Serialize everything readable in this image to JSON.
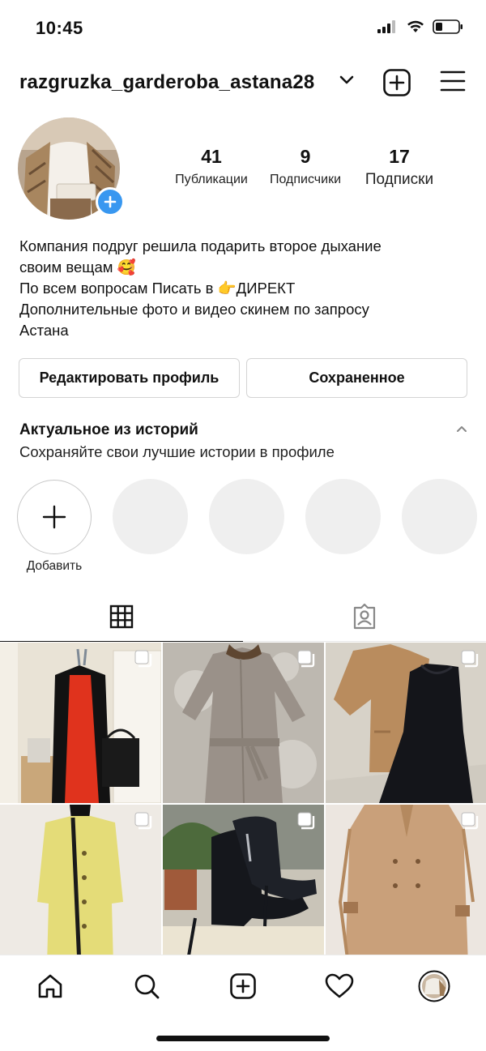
{
  "status_bar": {
    "time": "10:45"
  },
  "header": {
    "username": "razgruzka_garderoba_astana28"
  },
  "stats": [
    {
      "value": "41",
      "label": "Публикации"
    },
    {
      "value": "9",
      "label": "Подписчики"
    },
    {
      "value": "17",
      "label": "Подписки"
    }
  ],
  "bio": [
    "Компания подруг решила подарить второе дыхание",
    "своим вещам 🥰",
    "По всем вопросам Писать в 👉ДИРЕКТ",
    "Дополнительные фото и видео скинем по запросу",
    "Астана"
  ],
  "buttons": {
    "edit_profile": "Редактировать профиль",
    "saved": "Сохраненное"
  },
  "highlights": {
    "title": "Актуальное из историй",
    "subtitle": "Сохраняйте свои лучшие истории в профиле",
    "add_label": "Добавить"
  },
  "tabs": {
    "active": "grid"
  },
  "posts": [
    {
      "subject": "black cardigan and red dress on mannequin"
    },
    {
      "subject": "grey belted coat with fur collar"
    },
    {
      "subject": "camel blazer and black dress"
    },
    {
      "subject": "yellow coat on mannequin"
    },
    {
      "subject": "black platform ankle boots"
    },
    {
      "subject": "beige trench coat"
    }
  ],
  "bottom_nav": [
    "home",
    "search",
    "new-post",
    "activity",
    "profile"
  ],
  "colors": {
    "accent": "#3897f0",
    "text": "#111111",
    "border": "#d4d4d4",
    "highlight_placeholder": "#efefef"
  }
}
